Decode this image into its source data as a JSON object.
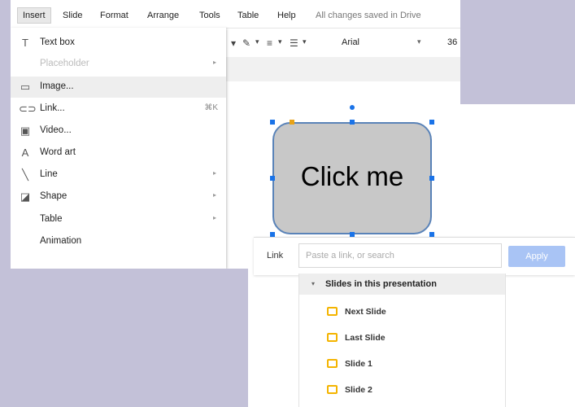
{
  "menubar": {
    "items": [
      "Insert",
      "Slide",
      "Format",
      "Arrange",
      "Tools",
      "Table",
      "Help"
    ],
    "status": "All changes saved in Drive"
  },
  "toolbar": {
    "font": "Arial",
    "font_size": "36"
  },
  "insert_menu": {
    "items": [
      {
        "label": "Text box",
        "icon": "text-box-icon",
        "shortcut": "",
        "submenu": false,
        "disabled": false
      },
      {
        "label": "Placeholder",
        "icon": "",
        "shortcut": "",
        "submenu": true,
        "disabled": true
      },
      {
        "label": "Image...",
        "icon": "image-icon",
        "shortcut": "",
        "submenu": false,
        "disabled": false
      },
      {
        "label": "Link...",
        "icon": "link-icon",
        "shortcut": "⌘K",
        "submenu": false,
        "disabled": false
      },
      {
        "label": "Video...",
        "icon": "video-icon",
        "shortcut": "",
        "submenu": false,
        "disabled": false
      },
      {
        "label": "Word art",
        "icon": "word-art-icon",
        "shortcut": "",
        "submenu": false,
        "disabled": false
      },
      {
        "label": "Line",
        "icon": "line-icon",
        "shortcut": "",
        "submenu": true,
        "disabled": false
      },
      {
        "label": "Shape",
        "icon": "shape-icon",
        "shortcut": "",
        "submenu": true,
        "disabled": false
      },
      {
        "label": "Table",
        "icon": "",
        "shortcut": "",
        "submenu": true,
        "disabled": false
      },
      {
        "label": "Animation",
        "icon": "",
        "shortcut": "",
        "submenu": false,
        "disabled": false
      }
    ],
    "highlighted": "Image..."
  },
  "shape": {
    "text": "Click me",
    "fill": "#c8c8c8",
    "border": "#5a83b8"
  },
  "link_bar": {
    "label": "Link",
    "placeholder": "Paste a link, or search",
    "apply": "Apply"
  },
  "slides_dropdown": {
    "header": "Slides in this presentation",
    "items": [
      "Next Slide",
      "Last Slide",
      "Slide 1",
      "Slide 2"
    ]
  },
  "colors": {
    "background": "#c3c1d8",
    "accent": "#1a73e8",
    "apply_button": "#a9c4f5",
    "slide_icon": "#f4b400"
  }
}
